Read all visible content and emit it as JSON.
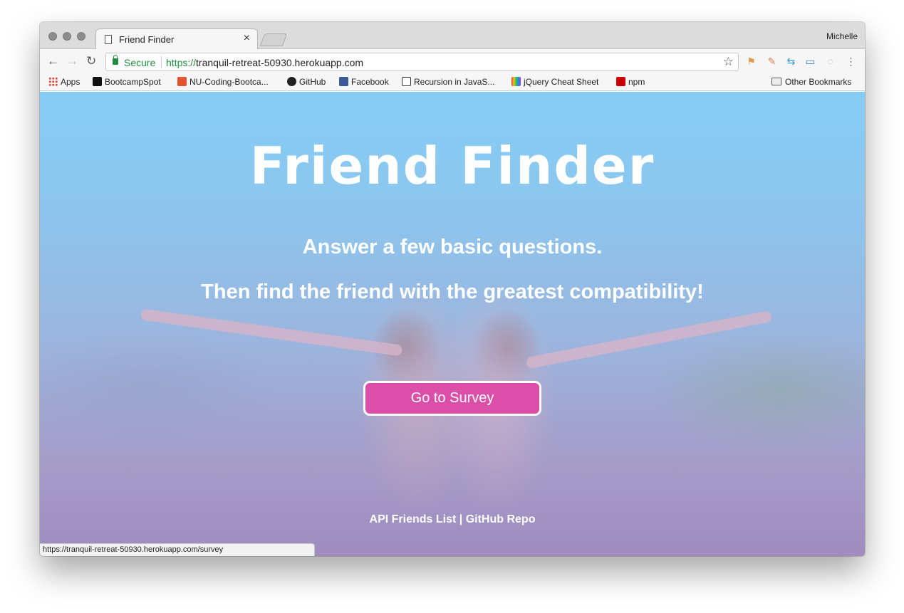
{
  "browser": {
    "profile_name": "Michelle",
    "tab": {
      "title": "Friend Finder"
    },
    "omnibox": {
      "secure_label": "Secure",
      "url_scheme": "https://",
      "url_host": "tranquil-retreat-50930.herokuapp.com"
    },
    "bookmarks": [
      {
        "label": "Apps",
        "icon": "apps-grid-icon"
      },
      {
        "label": "BootcampSpot",
        "icon": "bootcampspot-icon"
      },
      {
        "label": "NU-Coding-Bootca...",
        "icon": "gitlab-icon"
      },
      {
        "label": "GitHub",
        "icon": "github-icon"
      },
      {
        "label": "Facebook",
        "icon": "facebook-icon"
      },
      {
        "label": "Recursion in JavaS...",
        "icon": "codepen-icon"
      },
      {
        "label": "jQuery Cheat Sheet",
        "icon": "rainbow-icon"
      },
      {
        "label": "npm",
        "icon": "npm-icon"
      }
    ],
    "other_bookmarks": "Other Bookmarks",
    "status_url": "https://tranquil-retreat-50930.herokuapp.com/survey"
  },
  "page": {
    "title": "Friend Finder",
    "line1": "Answer a few basic questions.",
    "line2": "Then find the friend with the greatest compatibility!",
    "survey_button": "Go to Survey",
    "footer_api": "API Friends List",
    "footer_separator": "|",
    "footer_github": "GitHub Repo"
  },
  "colors": {
    "button_fill": "#dc4fa8",
    "secure_green": "#1e8e3e"
  }
}
